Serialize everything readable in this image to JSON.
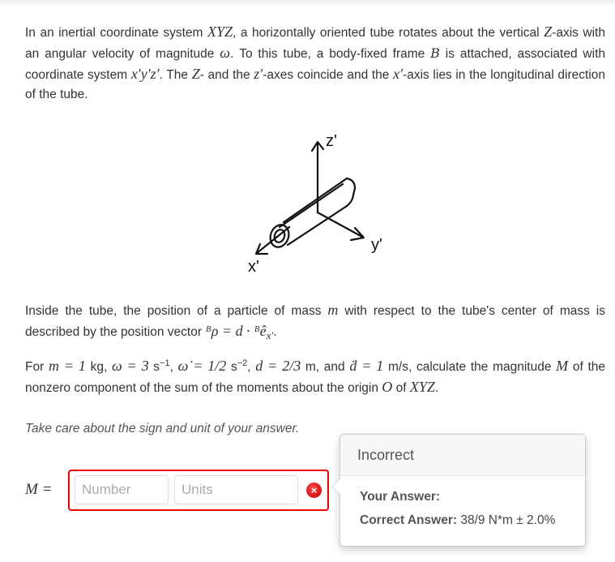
{
  "problem": {
    "p1": {
      "t1": "In an inertial coordinate system ",
      "XYZ": "XYZ",
      "t2": ", a horizontally oriented tube rotates about the vertical ",
      "Z": "Z",
      "t3": "-axis with an angular velocity of magnitude ",
      "omega": "ω",
      "t4": ". To this tube, a body-fixed frame ",
      "B": "B",
      "t5": " is attached, associated with coordinate system ",
      "xyz": "x′y′z′",
      "t6": ". The ",
      "Z2": "Z",
      "t7": "- and the ",
      "z": "z′",
      "t8": "-axes coincide and the ",
      "x": "x′",
      "t9": "-axis lies in the longitudinal direction of the tube."
    },
    "figure": {
      "labels": {
        "z": "z'",
        "y": "y'",
        "x": "x'"
      }
    },
    "p2": {
      "t1": "Inside the tube, the position of a particle of mass ",
      "m": "m",
      "t2": " with respect to the tube's center of mass is described by the position vector ",
      "eq": "ᴮρ = d · ᴮê",
      "sub": "x′",
      "t3": "."
    },
    "p3": {
      "t1": "For ",
      "v1": "m = 1",
      "u1": " kg, ",
      "v2": "ω = 3",
      "u2": " s",
      "e2": "−1",
      "s2": ", ",
      "v3": "ω̇ = 1/2",
      "u3": " s",
      "e3": "−2",
      "s3": ", ",
      "v4": "d = 2/3",
      "u4": " m, and ",
      "v5": "ḋ = 1",
      "u5": " m/s, calculate the magnitude ",
      "M": "M",
      "t2": " of the nonzero component of the sum of the moments about the origin ",
      "O": "O",
      "t3": " of ",
      "XYZ": "XYZ",
      "t4": "."
    },
    "hint": "Take care about the sign and unit of your answer."
  },
  "answer": {
    "label": "M =",
    "number_placeholder": "Number",
    "number_value": "",
    "units_placeholder": "Units",
    "units_value": "",
    "status_icon": "error-icon",
    "status_symbol": "×",
    "error_color": "#e00000"
  },
  "feedback": {
    "title": "Incorrect",
    "your_answer_label": "Your Answer:",
    "your_answer_value": "",
    "correct_answer_label": "Correct Answer:",
    "correct_answer_value": "38/9 N*m ± 2.0%"
  }
}
